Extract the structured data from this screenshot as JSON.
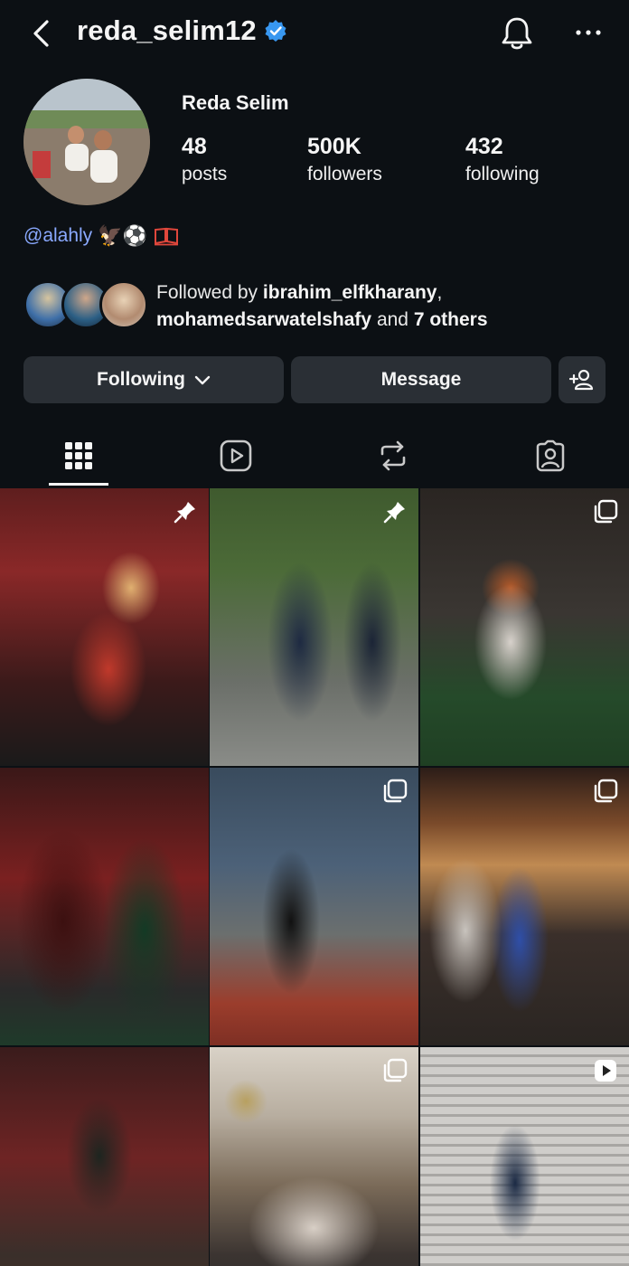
{
  "header": {
    "username": "reda_selim12",
    "verified": true,
    "icons": [
      "back-arrow-icon",
      "verified-badge-icon",
      "bell-icon",
      "more-horizontal-icon"
    ]
  },
  "profile": {
    "display_name": "Reda Selim",
    "stats": {
      "posts": {
        "value": "48",
        "label": "posts"
      },
      "followers": {
        "value": "500K",
        "label": "followers"
      },
      "following": {
        "value": "432",
        "label": "following"
      }
    },
    "bio": {
      "mention": "@alahly",
      "emojis": "🦅⚽"
    },
    "followed_by": {
      "prefix": "Followed by",
      "user1": "ibrahim_elfkharany",
      "separator": ",",
      "user2": "mohamedsarwatelshafy",
      "conjunction": "and",
      "others": "7 others"
    }
  },
  "actions": {
    "following_label": "Following",
    "message_label": "Message"
  },
  "tabs": [
    {
      "name": "posts-grid",
      "icon": "grid-icon",
      "active": true
    },
    {
      "name": "reels",
      "icon": "reels-icon",
      "active": false
    },
    {
      "name": "reposts",
      "icon": "repost-icon",
      "active": false
    },
    {
      "name": "tagged",
      "icon": "tagged-person-icon",
      "active": false
    }
  ],
  "grid": {
    "posts": [
      {
        "badge": "pin-icon"
      },
      {
        "badge": "pin-icon"
      },
      {
        "badge": "carousel-icon"
      },
      {
        "badge": ""
      },
      {
        "badge": "carousel-icon"
      },
      {
        "badge": "carousel-icon"
      },
      {
        "badge": ""
      },
      {
        "badge": "carousel-icon"
      },
      {
        "badge": "reel-icon"
      }
    ]
  },
  "colors": {
    "background": "#0c1014",
    "button": "#2a2f35",
    "link": "#8aa9ff",
    "verified": "#3897f0"
  }
}
